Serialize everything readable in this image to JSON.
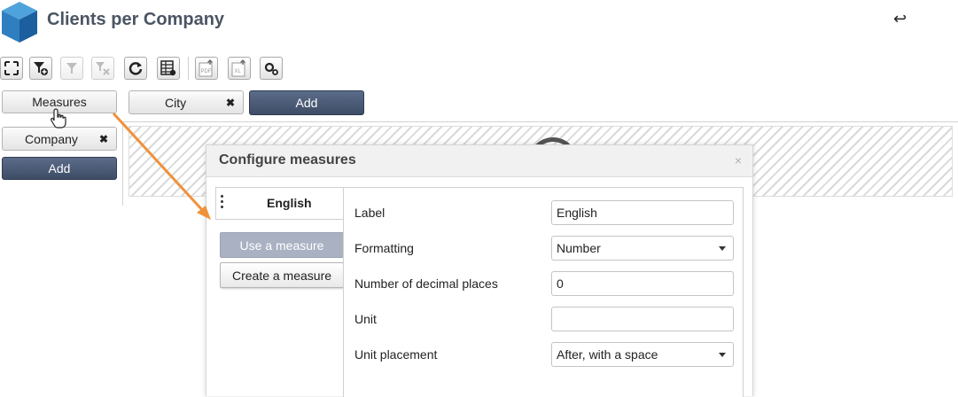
{
  "header": {
    "title": "Clients per Company",
    "logo_icon": "cube-logo",
    "back_icon": "back-arrow-icon"
  },
  "toolbar": {
    "buttons": [
      "fullscreen-icon",
      "add-filter-icon",
      "filter-icon",
      "clear-filter-icon",
      "refresh-icon",
      "table-settings-icon",
      "export-pdf-icon",
      "export-excel-icon",
      "settings-icon"
    ]
  },
  "left_panel": {
    "measures_label": "Measures",
    "company_label": "Company",
    "add_label": "Add"
  },
  "top_panel": {
    "city_label": "City",
    "add_label": "Add"
  },
  "dialog": {
    "title": "Configure measures",
    "close": "×",
    "measure_name": "English",
    "use_measure_label": "Use a measure",
    "create_measure_label": "Create a measure",
    "form": {
      "label_label": "Label",
      "label_value": "English",
      "formatting_label": "Formatting",
      "formatting_value": "Number",
      "decimals_label": "Number of decimal places",
      "decimals_value": "0",
      "unit_label": "Unit",
      "unit_value": "",
      "unit_placement_label": "Unit placement",
      "unit_placement_value": "After, with a space"
    }
  },
  "colors": {
    "accent_dark": "#45536e",
    "arrow": "#f0913a",
    "title": "#4b5563"
  }
}
